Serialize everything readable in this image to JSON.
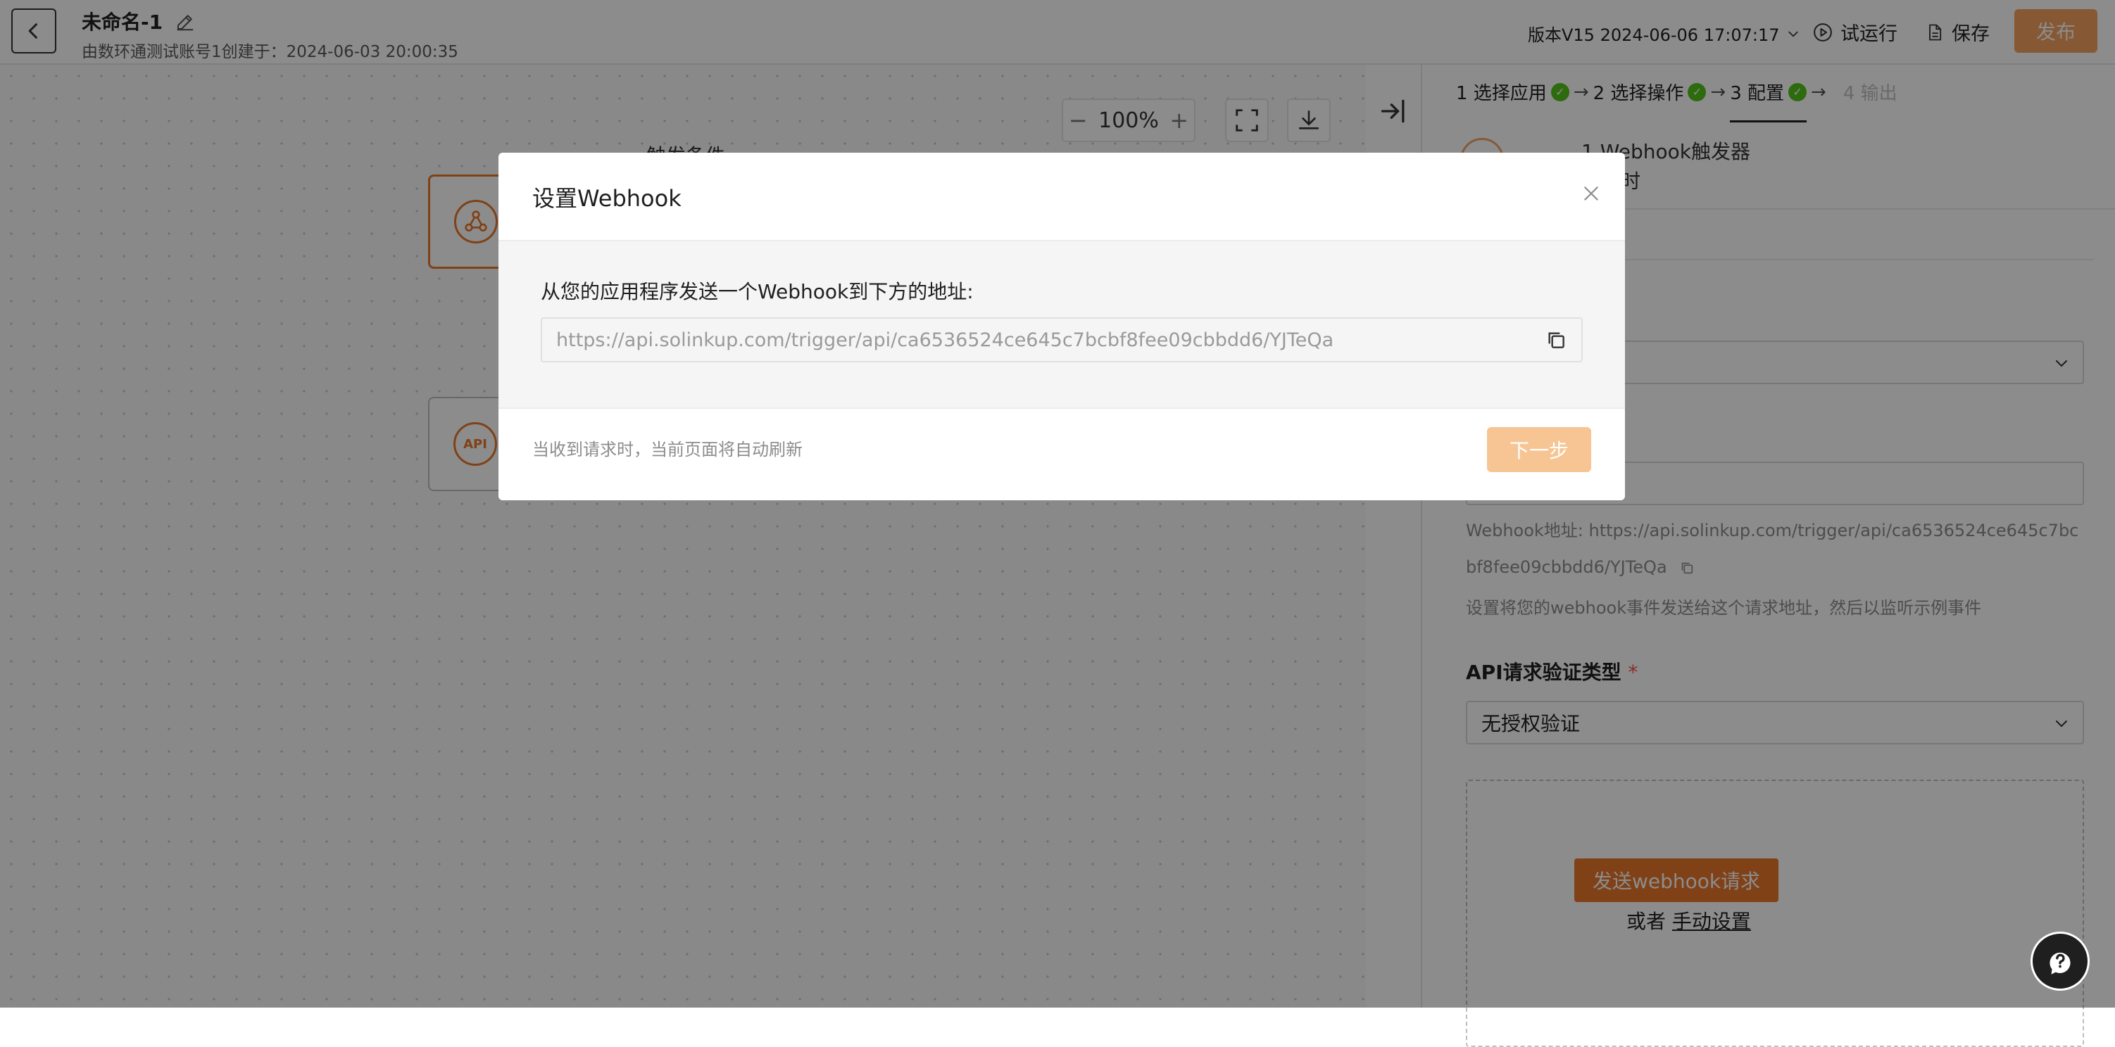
{
  "header": {
    "title": "未命名-1",
    "subtitle": "由数环通测试账号1创建于：2024-06-03 20:00:35",
    "version": "版本V15 2024-06-06 17:07:17",
    "test_run": "试运行",
    "save": "保存",
    "publish": "发布"
  },
  "canvas": {
    "zoom": "100%",
    "zoom_out": "−",
    "zoom_in": "+",
    "trigger_label": "触发条件",
    "api_badge": "API"
  },
  "panel": {
    "steps": [
      {
        "label": "1 选择应用",
        "state": "done"
      },
      {
        "label": "2 选择操作",
        "state": "done"
      },
      {
        "label": "3 配置",
        "state": "active"
      },
      {
        "label": "4 输出",
        "state": "disabled"
      }
    ],
    "trigger_title": "1 Webhook触发器",
    "trigger_sub": "请求时",
    "webhook_address": "Webhook地址: https://api.solinkup.com/trigger/api/ca6536524ce645c7bcbf8fee09cbbdd6/YJTeQa",
    "webhook_help": "设置将您的webhook事件发送给这个请求地址，然后以监听示例事件",
    "auth_label": "API请求验证类型",
    "auth_required": "*",
    "auth_value": "无授权验证",
    "send_button": "发送webhook请求",
    "or_text": "或者",
    "manual_link": "手动设置"
  },
  "modal": {
    "title": "设置Webhook",
    "prompt": "从您的应用程序发送一个Webhook到下方的地址:",
    "url": "https://api.solinkup.com/trigger/api/ca6536524ce645c7bcbf8fee09cbbdd6/YJTeQa",
    "footer_note": "当收到请求时，当前页面将自动刷新",
    "next_button": "下一步"
  },
  "colors": {
    "accent": "#e9772a",
    "success": "#52c41a",
    "overlay": "rgba(0,0,0,0.45)"
  }
}
